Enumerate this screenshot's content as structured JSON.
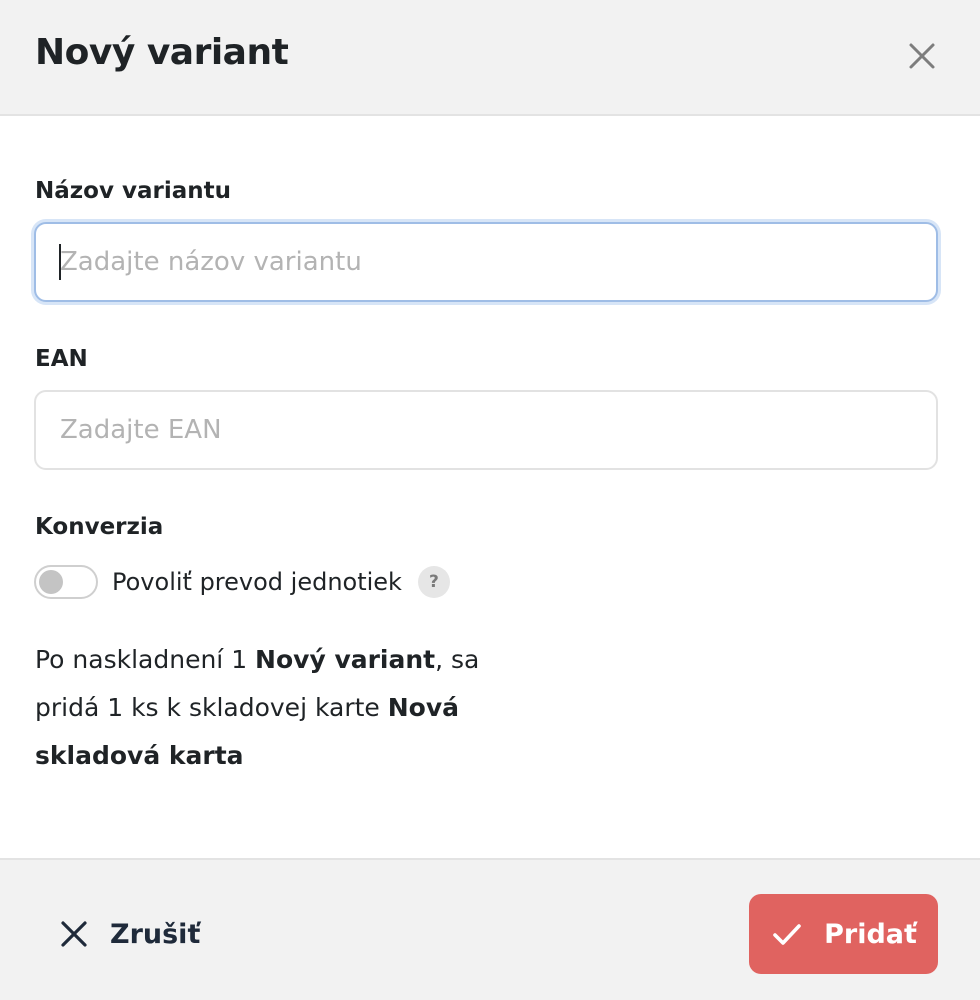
{
  "dialog": {
    "title": "Nový variant"
  },
  "form": {
    "name_field": {
      "label": "Názov variantu",
      "value": "",
      "placeholder": "Zadajte názov variantu"
    },
    "ean_field": {
      "label": "EAN",
      "value": "",
      "placeholder": "Zadajte EAN"
    },
    "conversion": {
      "label": "Konverzia",
      "toggle_label": "Povoliť prevod jednotiek",
      "toggle_on": false,
      "help_glyph": "?"
    },
    "info": {
      "part1": "Po naskladnení 1 ",
      "variant_name": "Nový variant",
      "part2": ", sa pridá 1 ks k skladovej karte ",
      "card_name": "Nová skladová karta"
    }
  },
  "footer": {
    "cancel_label": "Zrušiť",
    "submit_label": "Pridať"
  },
  "colors": {
    "accent": "#e06360",
    "header_bg": "#f2f2f2",
    "focus_border": "#9fbde6",
    "text": "#1f2326"
  },
  "icons": {
    "close": "close-icon",
    "help": "question-mark-icon",
    "cancel": "x-icon",
    "submit": "checkmark-icon"
  }
}
